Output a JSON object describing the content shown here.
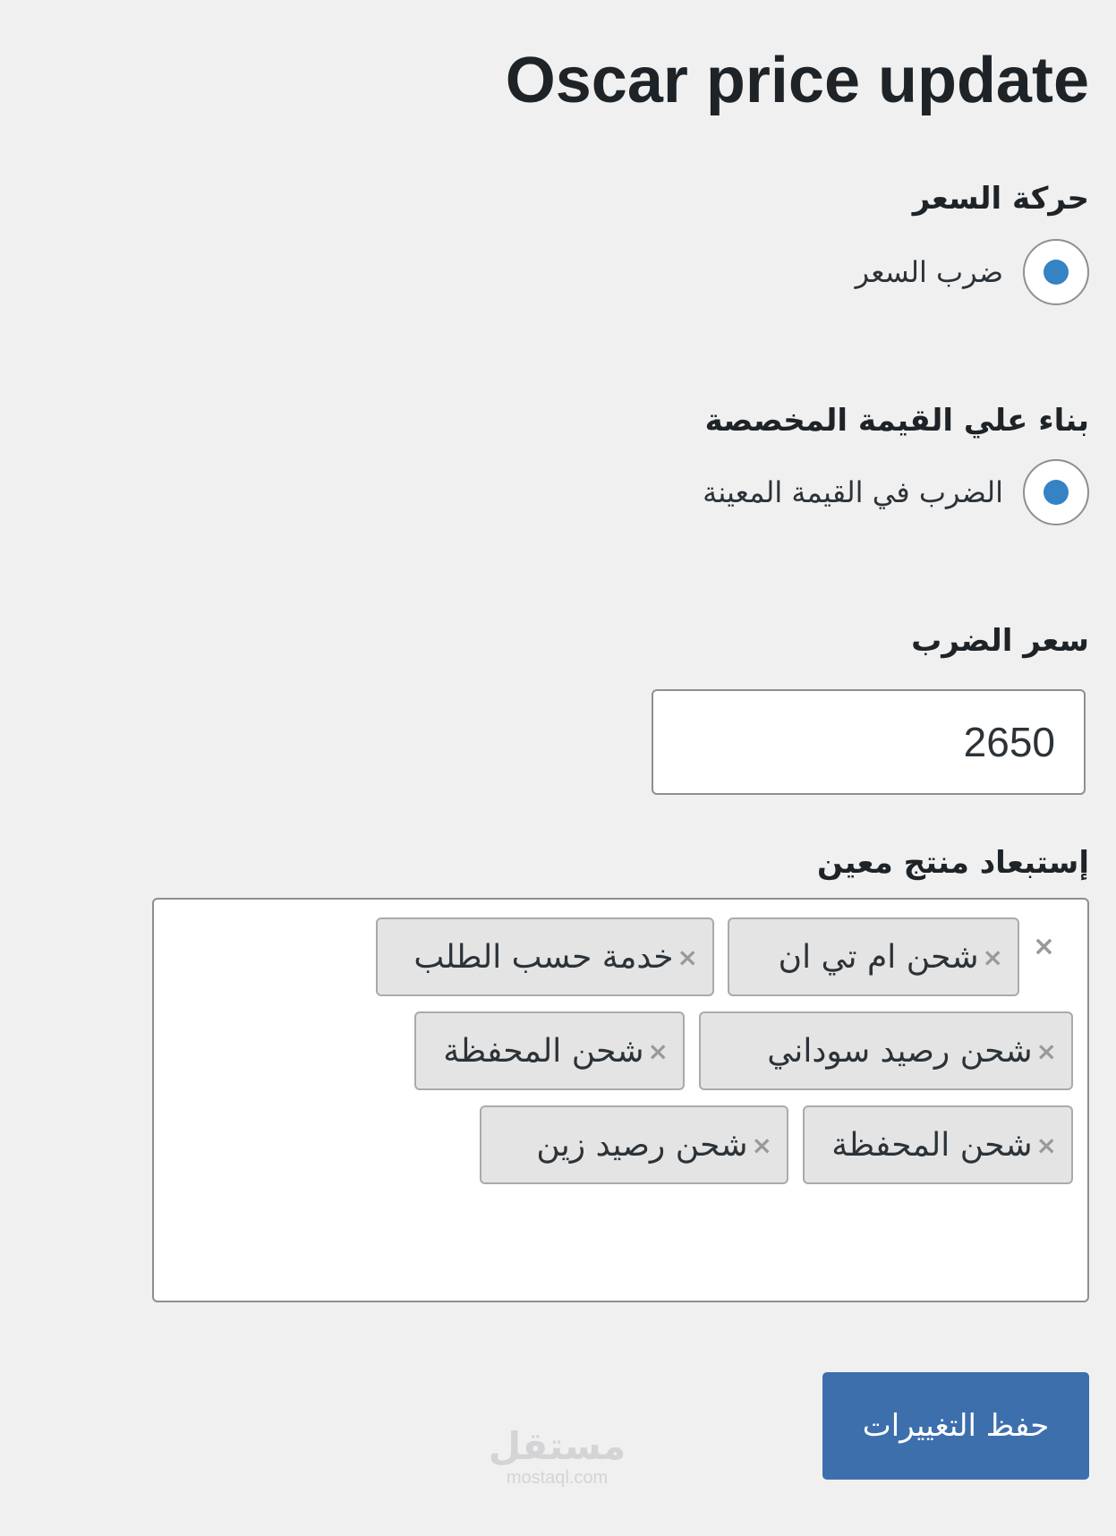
{
  "page": {
    "title": "Oscar price update"
  },
  "price_movement": {
    "label": "حركة السعر",
    "option_label": "ضرب السعر",
    "selected": true
  },
  "custom_value": {
    "label": "بناء علي القيمة المخصصة",
    "option_label": "الضرب في القيمة المعينة",
    "selected": true
  },
  "multiply_price": {
    "label": "سعر الضرب",
    "value": "2650"
  },
  "exclude_products": {
    "label": "إستبعاد منتج معين",
    "clear_symbol": "×",
    "tags": [
      {
        "text": "شحن ام تي ان",
        "remove_symbol": "×"
      },
      {
        "text": "خدمة حسب الطلب",
        "remove_symbol": "×"
      },
      {
        "text": "شحن رصيد سوداني",
        "remove_symbol": "×"
      },
      {
        "text": "شحن المحفظة",
        "remove_symbol": "×"
      },
      {
        "text": "شحن المحفظة",
        "remove_symbol": "×"
      },
      {
        "text": "شحن رصيد زين",
        "remove_symbol": "×"
      }
    ]
  },
  "actions": {
    "save_label": "حفظ التغييرات"
  },
  "watermark": {
    "arabic": "مستقل",
    "latin": "mostaql.com"
  },
  "colors": {
    "background": "#f0f0f1",
    "accent": "#3582c4",
    "button": "#3d6fad",
    "tag_bg": "#e4e4e4"
  }
}
